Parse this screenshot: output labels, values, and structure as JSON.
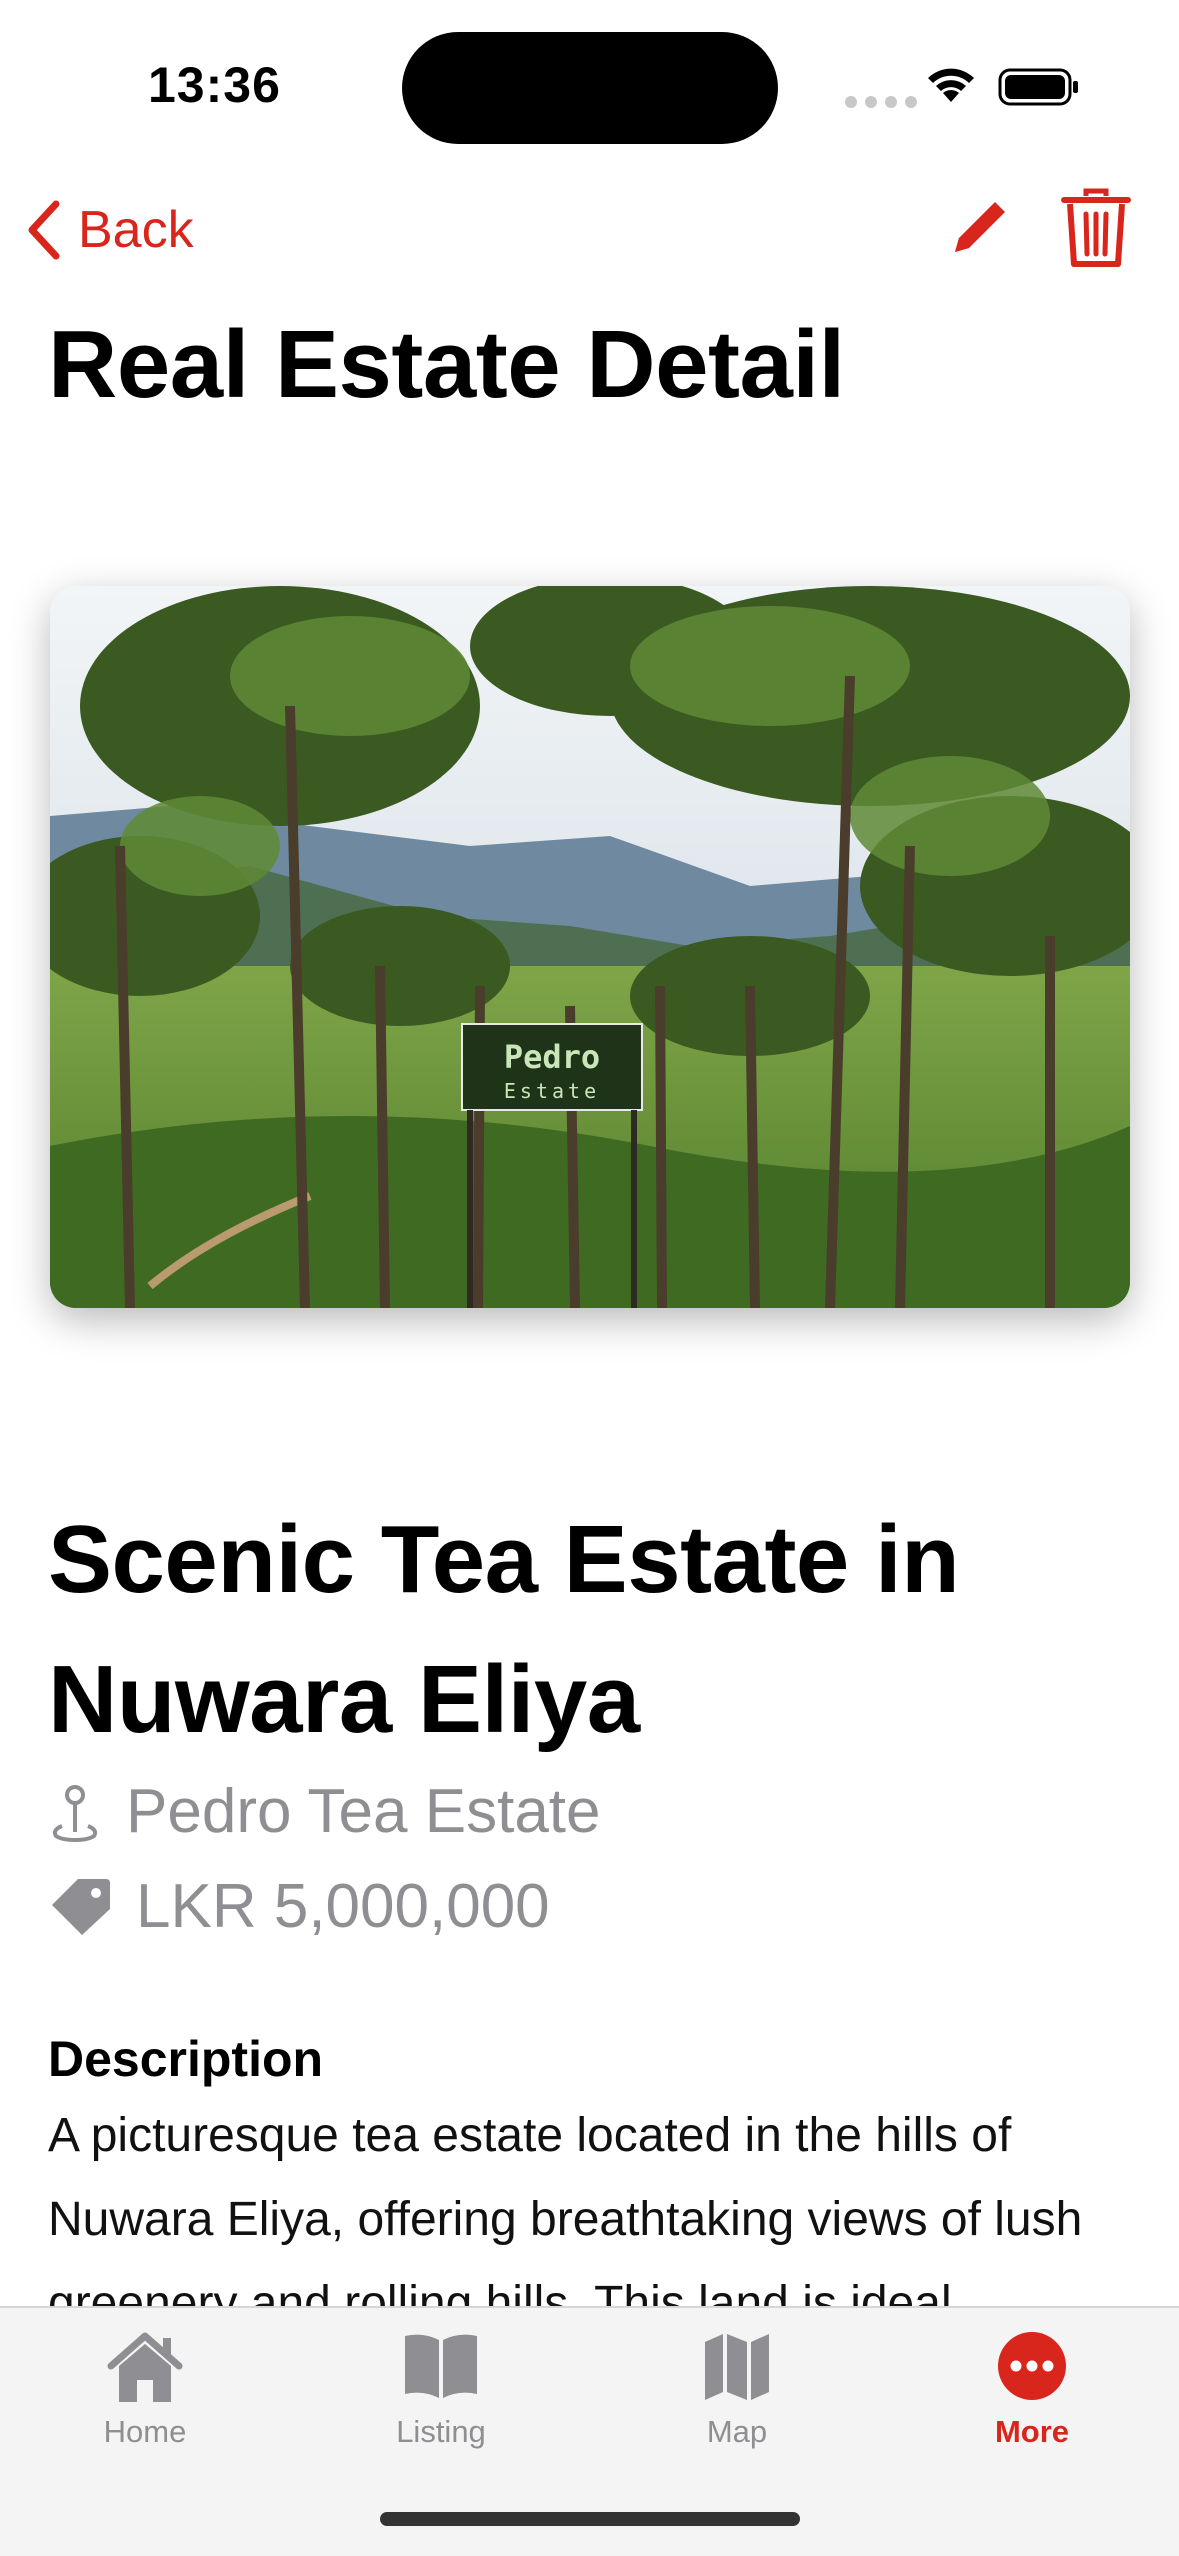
{
  "status_bar": {
    "time": "13:36"
  },
  "nav": {
    "back_label": "Back"
  },
  "page_title": "Real Estate Detail",
  "listing": {
    "title": "Scenic Tea Estate in Nuwara Eliya",
    "location": "Pedro Tea Estate",
    "price": "LKR 5,000,000",
    "photo_sign_line1": "Pedro",
    "photo_sign_line2": "Estate"
  },
  "description": {
    "heading": "Description",
    "text": "A picturesque tea estate located in the hills of Nuwara Eliya, offering breathtaking views of lush greenery and rolling hills. This land is ideal"
  },
  "tabs": [
    {
      "label": "Home",
      "icon": "house-icon",
      "active": false
    },
    {
      "label": "Listing",
      "icon": "book-icon",
      "active": false
    },
    {
      "label": "Map",
      "icon": "map-icon",
      "active": false
    },
    {
      "label": "More",
      "icon": "more-icon",
      "active": true
    }
  ],
  "colors": {
    "accent": "#d8261c",
    "secondary_text": "#8e8e93",
    "tab_bar": "#f4f4f4"
  }
}
